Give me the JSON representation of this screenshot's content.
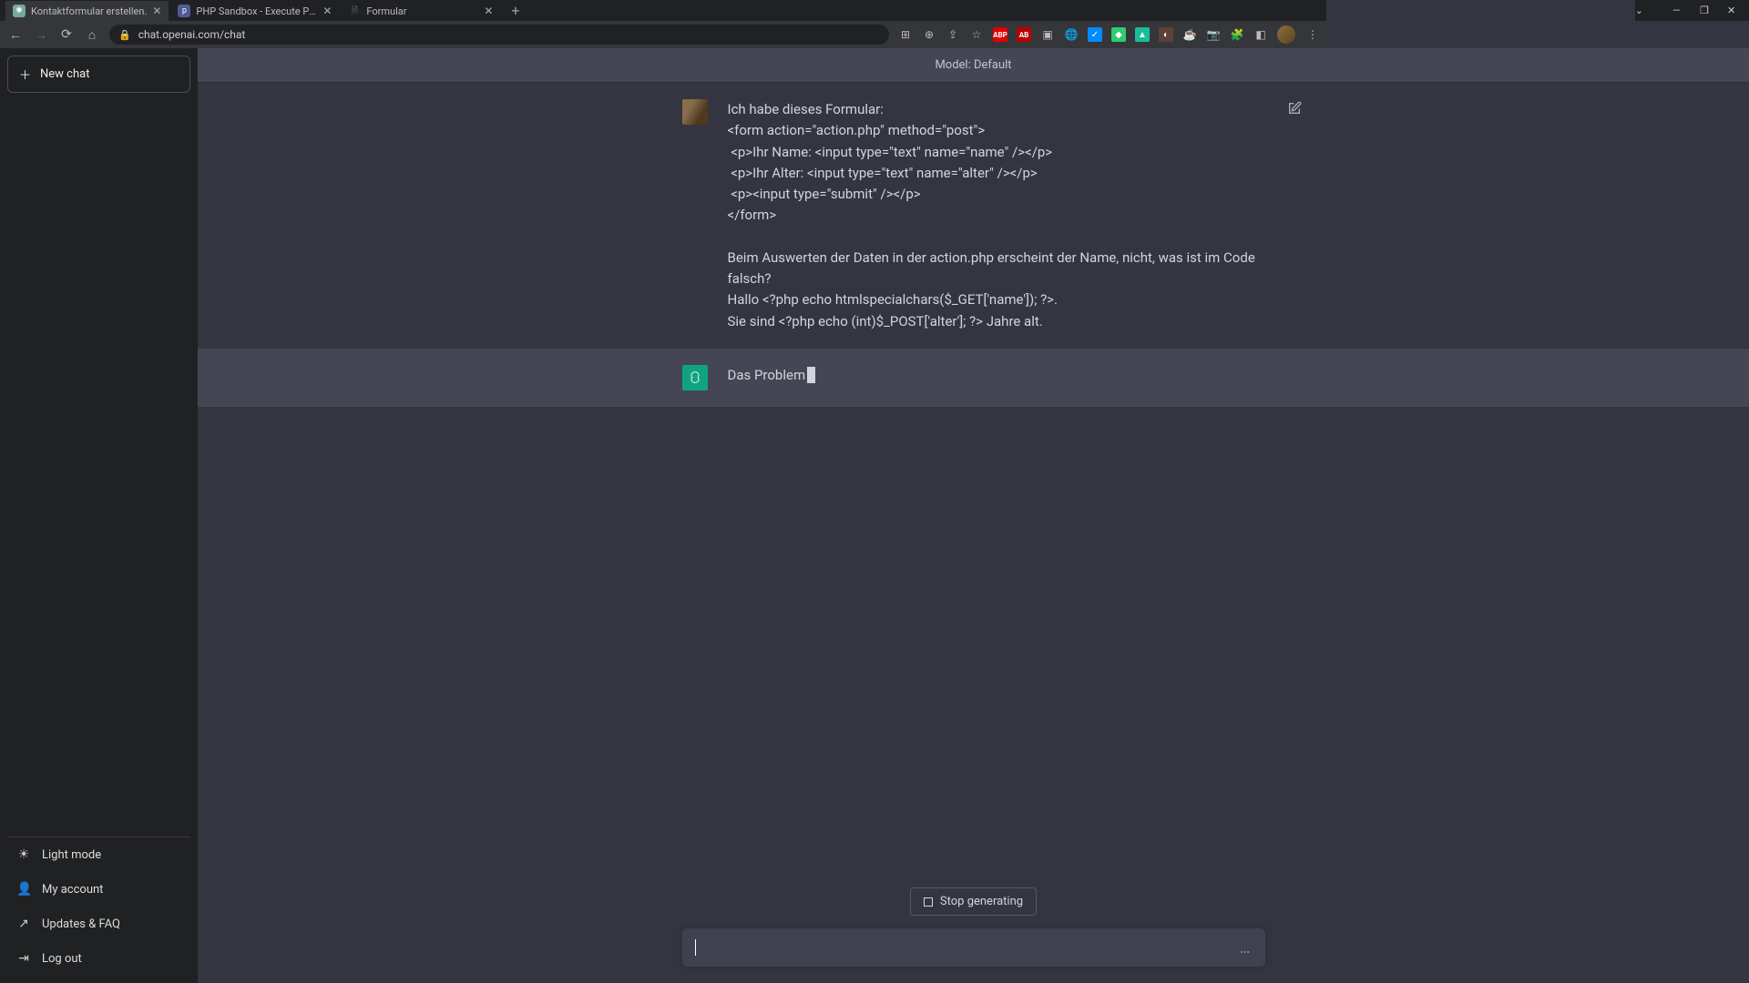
{
  "tabs": [
    {
      "title": "Kontaktformular erstellen.",
      "active": true,
      "favicon": "chatgpt"
    },
    {
      "title": "PHP Sandbox - Execute PHP cod",
      "active": false,
      "favicon": "php"
    },
    {
      "title": "Formular",
      "active": false,
      "favicon": "form"
    }
  ],
  "url": {
    "display": "chat.openai.com/chat"
  },
  "toolbar_icons": [
    "translate",
    "zoom",
    "share",
    "star",
    "abp",
    "abp2",
    "cast",
    "globe",
    "bluecheck",
    "green",
    "teal",
    "drk",
    "kofi",
    "camera",
    "puzzle",
    "panel",
    "avatar",
    "dots"
  ],
  "sidebar": {
    "new_chat": "New chat",
    "items": {
      "light_mode": "Light mode",
      "my_account": "My account",
      "updates_faq": "Updates & FAQ",
      "log_out": "Log out"
    }
  },
  "model_label": "Model: Default",
  "messages": {
    "user": {
      "text": "Ich habe dieses Formular:\n<form action=\"action.php\" method=\"post\">\n <p>Ihr Name: <input type=\"text\" name=\"name\" /></p>\n <p>Ihr Alter: <input type=\"text\" name=\"alter\" /></p>\n <p><input type=\"submit\" /></p>\n</form>\n\nBeim Auswerten der Daten in der action.php erscheint der Name, nicht, was ist im Code falsch?\nHallo <?php echo htmlspecialchars($_GET['name']); ?>.\nSie sind <?php echo (int)$_POST['alter']; ?> Jahre alt."
    },
    "assistant": {
      "text": "Das Problem"
    }
  },
  "stop_generating": "Stop generating",
  "input_placeholder": ""
}
